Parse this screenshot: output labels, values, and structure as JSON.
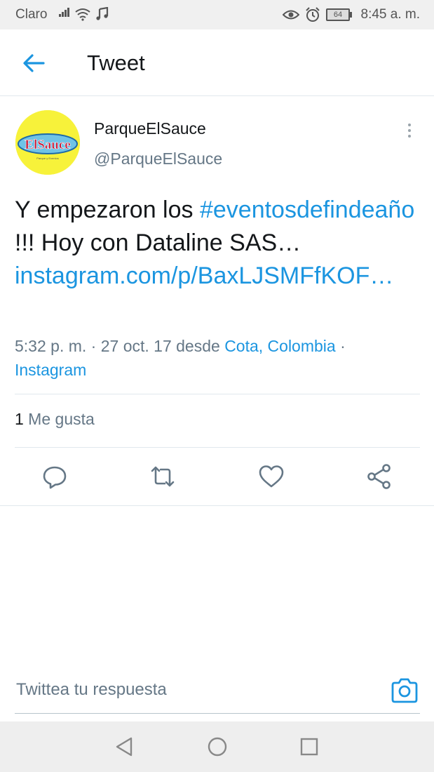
{
  "status_bar": {
    "carrier": "Claro",
    "battery": "64",
    "time": "8:45 a. m."
  },
  "header": {
    "title": "Tweet"
  },
  "tweet": {
    "user_name": "ParqueElSauce",
    "user_handle": "@ParqueElSauce",
    "avatar_text": "ElSauce",
    "text_plain_1": "Y empezaron los ",
    "hashtag": "#eventosdefindeaño",
    "text_plain_2": " !!! Hoy con Dataline SAS… ",
    "link": "instagram.com/p/BaxLJSMFfKOF…",
    "timestamp": "5:32 p. m. · 27 oct. 17 desde ",
    "location": "Cota, Colombia",
    "separator": " · ",
    "source": "Instagram",
    "likes_count": "1",
    "likes_label": " Me gusta"
  },
  "reply": {
    "placeholder": "Twittea tu respuesta"
  },
  "colors": {
    "accent": "#1b95e0",
    "secondary_text": "#657786",
    "icon_gray": "#657786",
    "avatar_bg": "#f7f23a"
  }
}
